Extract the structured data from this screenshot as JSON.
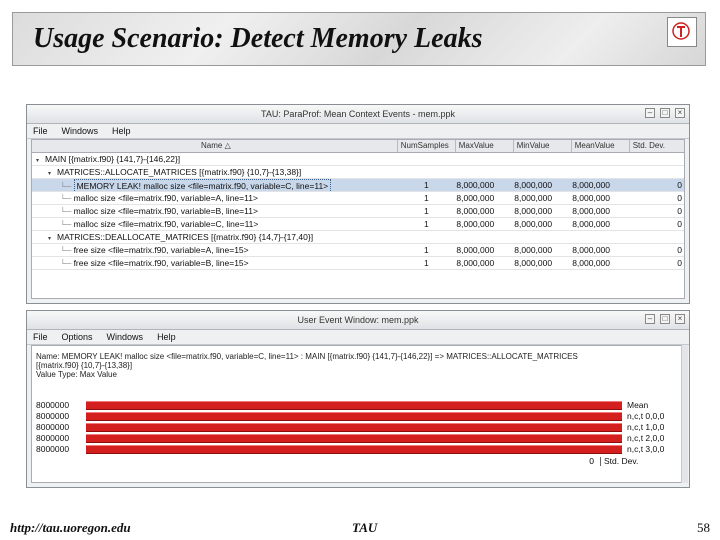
{
  "slide": {
    "title": "Usage Scenario: Detect Memory Leaks",
    "footer_url": "http://tau.uoregon.edu",
    "footer_center": "TAU",
    "page_number": "58"
  },
  "window1": {
    "title": "TAU: ParaProf: Mean Context Events - mem.ppk",
    "menu": [
      "File",
      "Windows",
      "Help"
    ],
    "columns": [
      "Name",
      "NumSamples",
      "MaxValue",
      "MinValue",
      "MeanValue",
      "Std. Dev."
    ],
    "rows": [
      {
        "name": "MAIN [{matrix.f90} {141,7}-{146,22}]",
        "samples": "",
        "max": "",
        "min": "",
        "mean": "",
        "sd": ""
      },
      {
        "name": "MATRICES::ALLOCATE_MATRICES [{matrix.f90} {10,7}-{13,38}]",
        "samples": "",
        "max": "",
        "min": "",
        "mean": "",
        "sd": ""
      },
      {
        "name": "MEMORY LEAK! malloc size <file=matrix.f90, variable=C, line=11>",
        "samples": "1",
        "max": "8,000,000",
        "min": "8,000,000",
        "mean": "8,000,000",
        "sd": "0"
      },
      {
        "name": "malloc size <file=matrix.f90, variable=A, line=11>",
        "samples": "1",
        "max": "8,000,000",
        "min": "8,000,000",
        "mean": "8,000,000",
        "sd": "0"
      },
      {
        "name": "malloc size <file=matrix.f90, variable=B, line=11>",
        "samples": "1",
        "max": "8,000,000",
        "min": "8,000,000",
        "mean": "8,000,000",
        "sd": "0"
      },
      {
        "name": "malloc size <file=matrix.f90, variable=C, line=11>",
        "samples": "1",
        "max": "8,000,000",
        "min": "8,000,000",
        "mean": "8,000,000",
        "sd": "0"
      },
      {
        "name": "MATRICES::DEALLOCATE_MATRICES [{matrix.f90} {14,7}-{17,40}]",
        "samples": "",
        "max": "",
        "min": "",
        "mean": "",
        "sd": ""
      },
      {
        "name": "free size <file=matrix.f90, variable=A, line=15>",
        "samples": "1",
        "max": "8,000,000",
        "min": "8,000,000",
        "mean": "8,000,000",
        "sd": "0"
      },
      {
        "name": "free size <file=matrix.f90, variable=B, line=15>",
        "samples": "1",
        "max": "8,000,000",
        "min": "8,000,000",
        "mean": "8,000,000",
        "sd": "0"
      }
    ]
  },
  "window2": {
    "title": "User Event Window: mem.ppk",
    "menu": [
      "File",
      "Options",
      "Windows",
      "Help"
    ],
    "info_lines": [
      "Name: MEMORY LEAK! malloc size <file=matrix.f90, variable=C, line=11> : MAIN [{matrix.f90} {141,7}-{146,22}] => MATRICES::ALLOCATE_MATRICES",
      "[{matrix.f90} {10,7}-{13,38}]",
      "Value Type: Max Value"
    ],
    "bars": [
      {
        "value_label": "8000000",
        "value": 8000000,
        "label": "Mean"
      },
      {
        "value_label": "8000000",
        "value": 8000000,
        "label": "n,c,t 0,0,0"
      },
      {
        "value_label": "8000000",
        "value": 8000000,
        "label": "n,c,t 1,0,0"
      },
      {
        "value_label": "8000000",
        "value": 8000000,
        "label": "n,c,t 2,0,0"
      },
      {
        "value_label": "8000000",
        "value": 8000000,
        "label": "n,c,t 3,0,0"
      }
    ],
    "zero_row": {
      "value_label": "0",
      "label": "Std. Dev."
    },
    "max_value": 8000000
  }
}
